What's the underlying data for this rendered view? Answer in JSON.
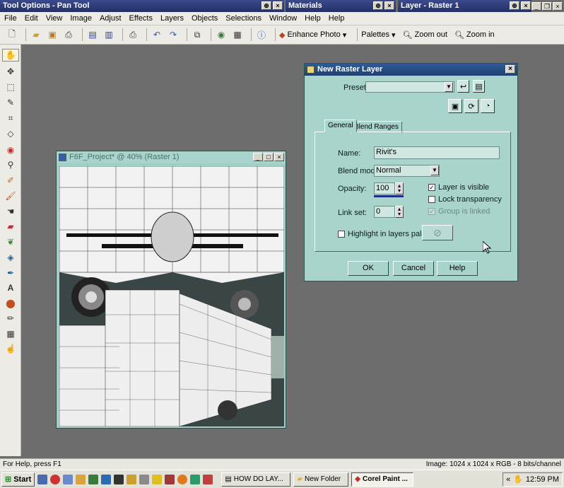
{
  "title_strips": {
    "tool_options": "Tool Options - Pan Tool",
    "materials": "Materials",
    "layer": "Layer - Raster 1"
  },
  "menubar": [
    "File",
    "Edit",
    "View",
    "Image",
    "Adjust",
    "Effects",
    "Layers",
    "Objects",
    "Selections",
    "Window",
    "Help",
    "Help"
  ],
  "toolbar": {
    "enhance_photo": "Enhance Photo",
    "palettes": "Palettes",
    "zoom_out": "Zoom out",
    "zoom_in": "Zoom in"
  },
  "image_window": {
    "title": "F6F_Project* @ 40% (Raster 1)"
  },
  "dialog": {
    "title": "New Raster Layer",
    "presets_label": "Presets:",
    "presets_value": "",
    "tabs": [
      "General",
      "Blend Ranges"
    ],
    "name_label": "Name:",
    "name_value": "Rivit's",
    "blend_mode_label": "Blend mode:",
    "blend_mode_value": "Normal",
    "opacity_label": "Opacity:",
    "opacity_value": "100",
    "link_set_label": "Link set:",
    "link_set_value": "0",
    "layer_visible_label": "Layer is visible",
    "lock_transparency_label": "Lock transparency",
    "group_linked_label": "Group is linked",
    "highlight_label": "Highlight in layers palette",
    "ok": "OK",
    "cancel": "Cancel",
    "help": "Help"
  },
  "statusbar": {
    "left": "For Help, press F1",
    "right": "Image:  1024 x 1024 x RGB - 8 bits/channel"
  },
  "taskbar": {
    "start": "Start",
    "tasks": [
      "HOW DO LAY...",
      "New Folder",
      "Corel Paint ..."
    ],
    "clock": "12:59 PM"
  },
  "colors": {
    "desktop_gray": "#6d6d6d",
    "dialog_bg": "#a9d4cc",
    "title_blue": "#233068"
  }
}
